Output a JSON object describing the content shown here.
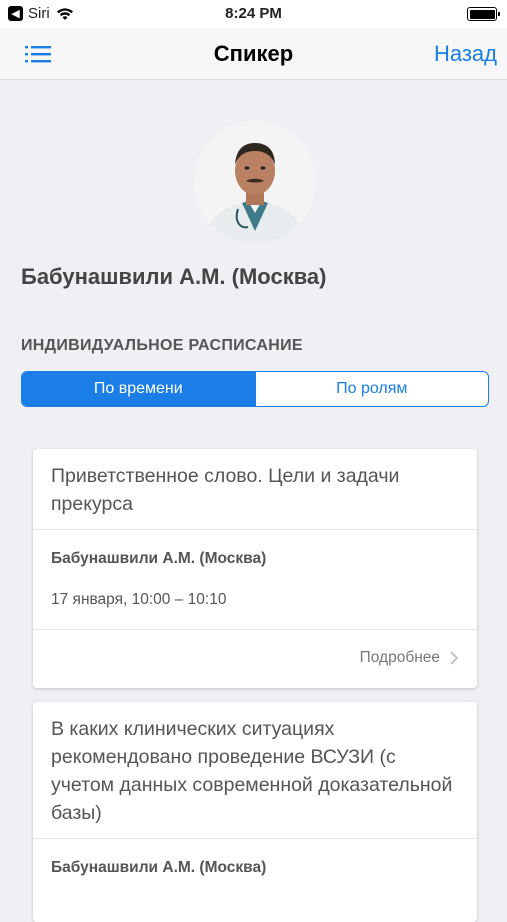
{
  "status_bar": {
    "back_app": "Siri",
    "time": "8:24 PM"
  },
  "nav": {
    "title": "Спикер",
    "back_label": "Назад"
  },
  "speaker": {
    "name": "Бабунашвили А.М. (Москва)"
  },
  "schedule": {
    "section_title": "ИНДИВИДУАЛЬНОЕ РАСПИСАНИЕ",
    "segments": [
      "По времени",
      "По ролям"
    ],
    "selected_segment": "По времени"
  },
  "sessions": [
    {
      "title": "Приветственное слово. Цели и задачи прекурса",
      "speaker": "Бабунашвили А.М. (Москва)",
      "time": "17 января, 10:00 – 10:10",
      "more_label": "Подробнее"
    },
    {
      "title": "В каких клинических ситуациях рекомендовано проведение ВСУЗИ (с учетом данных современной доказательной базы)",
      "speaker": "Бабунашвили А.М. (Москва)"
    }
  ],
  "colors": {
    "accent": "#1a7ee6",
    "background": "#efeff4"
  }
}
